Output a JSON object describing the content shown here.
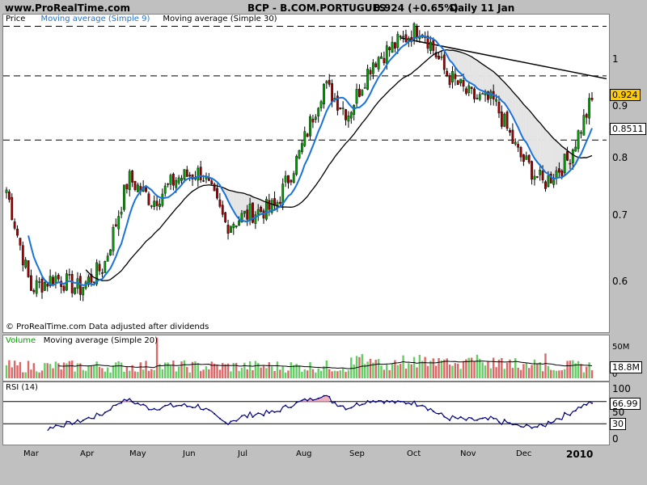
{
  "header": {
    "site": "www.ProRealTime.com",
    "instrument": "BCP - B.COM.PORTUGUES",
    "last_price": "0.924 (+0.65%)",
    "period": "Daily  11 Jan"
  },
  "price_panel": {
    "legend": [
      "Price",
      "Moving average (Simple 9)",
      "Moving average (Simple 30)"
    ],
    "footnote": "© ProRealTime.com  Data adjusted after dividends",
    "y_ticks": [
      "1",
      "0.9",
      "0.8",
      "0.7",
      "0.6"
    ],
    "last_value_label": "0.924",
    "ma30_value_label": "0.8511"
  },
  "volume_panel": {
    "legend_volume": "Volume",
    "legend_ma": "Moving average (Simple 20)",
    "y_ticks": [
      "50M",
      "0"
    ],
    "value_label": "18.8M"
  },
  "rsi_panel": {
    "legend": "RSI (14)",
    "y_ticks": [
      "100",
      "50",
      "0"
    ],
    "value_label": "66.99",
    "level_label": "30"
  },
  "x_axis_labels": [
    "Mar",
    "Apr",
    "May",
    "Jun",
    "Jul",
    "Aug",
    "Sep",
    "Oct",
    "Nov",
    "Dec",
    "2010"
  ],
  "colors": {
    "background": "#c0c0c0",
    "up_candle": "#00a000",
    "down_candle": "#a00000",
    "ma9": "#1a73d9",
    "ma30": "#000000",
    "volume_up": "#66cc66",
    "volume_down": "#dd6666",
    "rsi_line": "#000080",
    "last_label_bg": "#ffcc00"
  },
  "chart_data": [
    {
      "type": "candlestick",
      "title": "BCP - B.COM.PORTUGUES",
      "x_months": [
        "Mar",
        "Apr",
        "May",
        "Jun",
        "Jul",
        "Aug",
        "Sep",
        "Oct",
        "Nov",
        "Dec",
        "2010"
      ],
      "ylim": [
        0.53,
        1.07
      ],
      "last_close": 0.924,
      "anchor_closes": [
        0.77,
        0.6,
        0.62,
        0.6,
        0.64,
        0.79,
        0.75,
        0.79,
        0.8,
        0.71,
        0.73,
        0.74,
        0.83,
        0.95,
        0.9,
        0.99,
        1.02,
        1.05,
        0.97,
        0.93,
        0.92,
        0.83,
        0.78,
        0.82,
        0.924
      ],
      "horizontal_levels": [
        1.05,
        0.965,
        0.855
      ],
      "trendline": {
        "from": 1.03,
        "to": 0.96
      },
      "series": [
        {
          "name": "Moving average (Simple 9)",
          "period": 9
        },
        {
          "name": "Moving average (Simple 30)",
          "period": 30,
          "last": 0.8511
        }
      ]
    },
    {
      "type": "bar",
      "title": "Volume",
      "ylim": [
        0,
        60
      ],
      "unit": "M",
      "ma_last": 18.8
    },
    {
      "type": "line",
      "title": "RSI (14)",
      "ylim": [
        0,
        100
      ],
      "levels": [
        30,
        70
      ],
      "last": 66.99
    }
  ]
}
